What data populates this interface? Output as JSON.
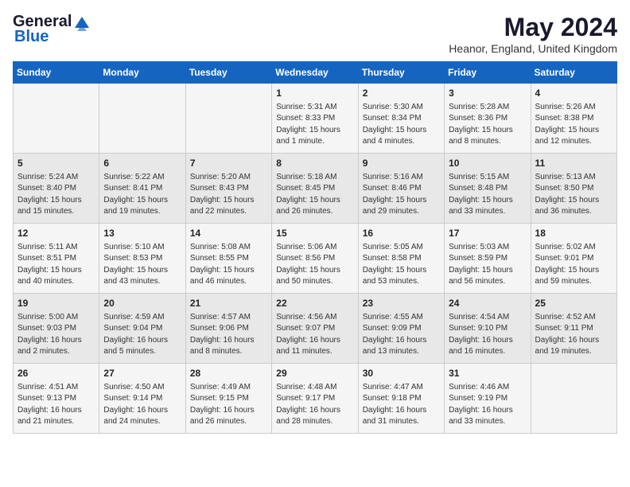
{
  "logo": {
    "general": "General",
    "blue": "Blue"
  },
  "title": {
    "month_year": "May 2024",
    "location": "Heanor, England, United Kingdom"
  },
  "weekdays": [
    "Sunday",
    "Monday",
    "Tuesday",
    "Wednesday",
    "Thursday",
    "Friday",
    "Saturday"
  ],
  "weeks": [
    [
      {
        "day": "",
        "content": ""
      },
      {
        "day": "",
        "content": ""
      },
      {
        "day": "",
        "content": ""
      },
      {
        "day": "1",
        "content": "Sunrise: 5:31 AM\nSunset: 8:33 PM\nDaylight: 15 hours\nand 1 minute."
      },
      {
        "day": "2",
        "content": "Sunrise: 5:30 AM\nSunset: 8:34 PM\nDaylight: 15 hours\nand 4 minutes."
      },
      {
        "day": "3",
        "content": "Sunrise: 5:28 AM\nSunset: 8:36 PM\nDaylight: 15 hours\nand 8 minutes."
      },
      {
        "day": "4",
        "content": "Sunrise: 5:26 AM\nSunset: 8:38 PM\nDaylight: 15 hours\nand 12 minutes."
      }
    ],
    [
      {
        "day": "5",
        "content": "Sunrise: 5:24 AM\nSunset: 8:40 PM\nDaylight: 15 hours\nand 15 minutes."
      },
      {
        "day": "6",
        "content": "Sunrise: 5:22 AM\nSunset: 8:41 PM\nDaylight: 15 hours\nand 19 minutes."
      },
      {
        "day": "7",
        "content": "Sunrise: 5:20 AM\nSunset: 8:43 PM\nDaylight: 15 hours\nand 22 minutes."
      },
      {
        "day": "8",
        "content": "Sunrise: 5:18 AM\nSunset: 8:45 PM\nDaylight: 15 hours\nand 26 minutes."
      },
      {
        "day": "9",
        "content": "Sunrise: 5:16 AM\nSunset: 8:46 PM\nDaylight: 15 hours\nand 29 minutes."
      },
      {
        "day": "10",
        "content": "Sunrise: 5:15 AM\nSunset: 8:48 PM\nDaylight: 15 hours\nand 33 minutes."
      },
      {
        "day": "11",
        "content": "Sunrise: 5:13 AM\nSunset: 8:50 PM\nDaylight: 15 hours\nand 36 minutes."
      }
    ],
    [
      {
        "day": "12",
        "content": "Sunrise: 5:11 AM\nSunset: 8:51 PM\nDaylight: 15 hours\nand 40 minutes."
      },
      {
        "day": "13",
        "content": "Sunrise: 5:10 AM\nSunset: 8:53 PM\nDaylight: 15 hours\nand 43 minutes."
      },
      {
        "day": "14",
        "content": "Sunrise: 5:08 AM\nSunset: 8:55 PM\nDaylight: 15 hours\nand 46 minutes."
      },
      {
        "day": "15",
        "content": "Sunrise: 5:06 AM\nSunset: 8:56 PM\nDaylight: 15 hours\nand 50 minutes."
      },
      {
        "day": "16",
        "content": "Sunrise: 5:05 AM\nSunset: 8:58 PM\nDaylight: 15 hours\nand 53 minutes."
      },
      {
        "day": "17",
        "content": "Sunrise: 5:03 AM\nSunset: 8:59 PM\nDaylight: 15 hours\nand 56 minutes."
      },
      {
        "day": "18",
        "content": "Sunrise: 5:02 AM\nSunset: 9:01 PM\nDaylight: 15 hours\nand 59 minutes."
      }
    ],
    [
      {
        "day": "19",
        "content": "Sunrise: 5:00 AM\nSunset: 9:03 PM\nDaylight: 16 hours\nand 2 minutes."
      },
      {
        "day": "20",
        "content": "Sunrise: 4:59 AM\nSunset: 9:04 PM\nDaylight: 16 hours\nand 5 minutes."
      },
      {
        "day": "21",
        "content": "Sunrise: 4:57 AM\nSunset: 9:06 PM\nDaylight: 16 hours\nand 8 minutes."
      },
      {
        "day": "22",
        "content": "Sunrise: 4:56 AM\nSunset: 9:07 PM\nDaylight: 16 hours\nand 11 minutes."
      },
      {
        "day": "23",
        "content": "Sunrise: 4:55 AM\nSunset: 9:09 PM\nDaylight: 16 hours\nand 13 minutes."
      },
      {
        "day": "24",
        "content": "Sunrise: 4:54 AM\nSunset: 9:10 PM\nDaylight: 16 hours\nand 16 minutes."
      },
      {
        "day": "25",
        "content": "Sunrise: 4:52 AM\nSunset: 9:11 PM\nDaylight: 16 hours\nand 19 minutes."
      }
    ],
    [
      {
        "day": "26",
        "content": "Sunrise: 4:51 AM\nSunset: 9:13 PM\nDaylight: 16 hours\nand 21 minutes."
      },
      {
        "day": "27",
        "content": "Sunrise: 4:50 AM\nSunset: 9:14 PM\nDaylight: 16 hours\nand 24 minutes."
      },
      {
        "day": "28",
        "content": "Sunrise: 4:49 AM\nSunset: 9:15 PM\nDaylight: 16 hours\nand 26 minutes."
      },
      {
        "day": "29",
        "content": "Sunrise: 4:48 AM\nSunset: 9:17 PM\nDaylight: 16 hours\nand 28 minutes."
      },
      {
        "day": "30",
        "content": "Sunrise: 4:47 AM\nSunset: 9:18 PM\nDaylight: 16 hours\nand 31 minutes."
      },
      {
        "day": "31",
        "content": "Sunrise: 4:46 AM\nSunset: 9:19 PM\nDaylight: 16 hours\nand 33 minutes."
      },
      {
        "day": "",
        "content": ""
      }
    ]
  ]
}
